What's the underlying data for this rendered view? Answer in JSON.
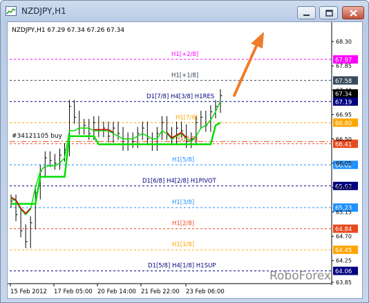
{
  "window": {
    "title": "NZDJPY,H1"
  },
  "chart": {
    "header": "NZDJPY,H1  67.29 67.34 67.26 67.34",
    "watermark": "RoboForex",
    "order_label": "#34121105 buy"
  },
  "colors": {
    "murrey_78": "#cc3399",
    "pink": "#ff00ff",
    "orange": "#ffa500",
    "red": "#e8491d",
    "blue": "#1e90ff",
    "navy": "#000080",
    "green_line": "#00e000",
    "red_line": "#d40000",
    "price_dark": "#2f3f55"
  },
  "chart_data": {
    "type": "line",
    "title": "NZDJPY,H1",
    "ohlc_last": {
      "open": 67.29,
      "high": 67.34,
      "low": 67.26,
      "close": 67.34
    },
    "y_ticks": [
      68.3,
      67.85,
      67.4,
      66.95,
      66.5,
      66.05,
      65.6,
      65.15,
      64.7,
      64.25,
      63.85
    ],
    "ylim": [
      63.8,
      68.6
    ],
    "x_tick_labels": [
      "15 Feb 2012",
      "17 Feb 05:00",
      "20 Feb 14:00",
      "21 Feb 22:00",
      "23 Feb 06:00"
    ],
    "levels": [
      {
        "label": "H1[+2/8]",
        "price": 67.97,
        "color": "#ff00ff",
        "tag_color": "#ff00ff",
        "tag_text": "#ffffff"
      },
      {
        "label": "H1[+1/8]",
        "price": 67.58,
        "color": "#2f3f55",
        "tag_color": "#3a4a5e",
        "tag_text": "#ffffff"
      },
      {
        "label": "D1[7/8] H4[3/8] H1RES",
        "price": 67.19,
        "color": "#000080",
        "tag_color": "#000080",
        "tag_text": "#ffffff"
      },
      {
        "label": "H1[7/8]",
        "price": 66.8,
        "color": "#ffa500",
        "tag_color": "#ffa500",
        "tag_text": "#ffffff"
      },
      {
        "label": "H1[6/8]",
        "price": 66.41,
        "color": "#e8491d",
        "tag_color": "#e8491d",
        "tag_text": "#ffffff"
      },
      {
        "label": "H1[5/8]",
        "price": 66.02,
        "color": "#1e90ff",
        "tag_color": "#1e90ff",
        "tag_text": "#ffffff"
      },
      {
        "label": "D1[6/8] H4[2/8] H1PIVOT",
        "price": 65.63,
        "color": "#000080",
        "tag_color": "#000080",
        "tag_text": "#ffffff"
      },
      {
        "label": "H1[3/8]",
        "price": 65.23,
        "color": "#1e90ff",
        "tag_color": "#1e90ff",
        "tag_text": "#ffffff"
      },
      {
        "label": "H1[2/8]",
        "price": 64.84,
        "color": "#e8491d",
        "tag_color": "#e8491d",
        "tag_text": "#ffffff"
      },
      {
        "label": "H1[1/8]",
        "price": 64.45,
        "color": "#ffa500",
        "tag_color": "#ffa500",
        "tag_text": "#ffffff"
      },
      {
        "label": "D1[5/8] H4[1/8] H1SUP",
        "price": 64.06,
        "color": "#000080",
        "tag_color": "#000080",
        "tag_text": "#ffffff"
      }
    ],
    "current_price": {
      "value": 67.34,
      "tag_color": "#000000",
      "tag_text": "#ffffff"
    },
    "order_price": 66.45,
    "price_series": [
      65.35,
      65.1,
      64.8,
      64.6,
      64.95,
      65.5,
      65.9,
      66.15,
      66.1,
      66.05,
      66.2,
      66.3,
      67.1,
      66.9,
      66.7,
      66.75,
      66.6,
      66.8,
      66.65,
      66.7,
      66.55,
      66.7,
      66.6,
      66.4,
      66.5,
      66.45,
      66.6,
      66.7,
      66.5,
      66.4,
      66.6,
      66.8,
      66.6,
      66.5,
      66.7,
      66.65,
      66.45,
      66.5,
      66.8,
      66.9,
      66.75,
      67.0,
      67.1,
      67.3
    ],
    "green_fast": [
      65.4,
      65.35,
      65.2,
      65.1,
      65.2,
      65.6,
      65.9,
      66.0,
      66.0,
      66.0,
      66.05,
      66.15,
      66.65,
      66.65,
      66.7,
      66.7,
      66.7,
      66.65,
      66.65,
      66.65,
      66.65,
      66.6,
      66.55,
      66.5,
      66.5,
      66.5,
      66.55,
      66.6,
      66.55,
      66.5,
      66.5,
      66.65,
      66.6,
      66.5,
      66.55,
      66.6,
      66.5,
      66.45,
      66.55,
      66.7,
      66.75,
      66.85,
      67.0,
      67.2
    ],
    "green_slow": [
      65.3,
      65.3,
      65.3,
      65.3,
      65.3,
      65.3,
      65.8,
      65.8,
      65.8,
      65.8,
      65.8,
      65.8,
      66.55,
      66.55,
      66.55,
      66.55,
      66.55,
      66.55,
      66.4,
      66.4,
      66.4,
      66.4,
      66.4,
      66.4,
      66.4,
      66.4,
      66.4,
      66.4,
      66.4,
      66.4,
      66.4,
      66.4,
      66.4,
      66.4,
      66.4,
      66.4,
      66.4,
      66.4,
      66.4,
      66.4,
      66.4,
      66.4,
      66.75,
      66.8
    ]
  }
}
